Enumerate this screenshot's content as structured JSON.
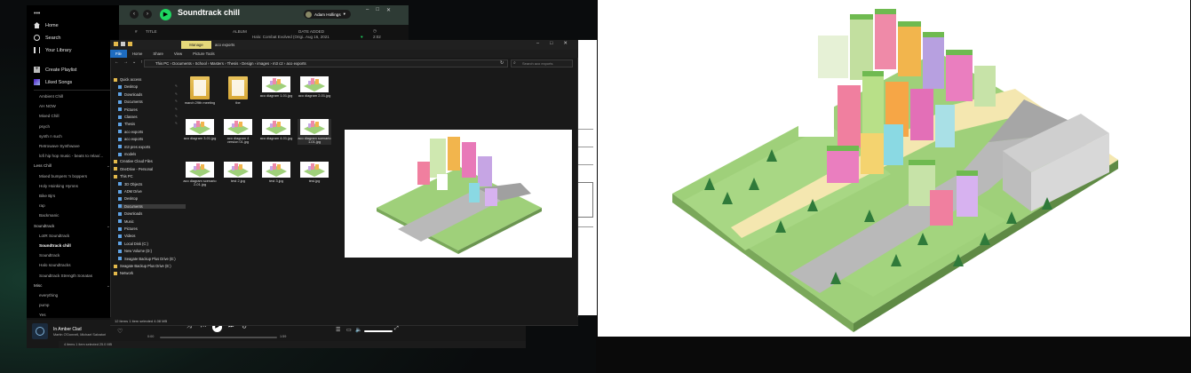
{
  "spotify": {
    "nav": {
      "home": "Home",
      "search": "Search",
      "library": "Your Library",
      "create": "Create Playlist",
      "liked": "Liked Songs"
    },
    "playlists": [
      {
        "label": "Ambient Chill",
        "type": "pl"
      },
      {
        "label": "AH NOW",
        "type": "pl"
      },
      {
        "label": "Mixed Chill",
        "type": "pl"
      },
      {
        "label": "psych",
        "type": "pl"
      },
      {
        "label": "synth n such",
        "type": "pl"
      },
      {
        "label": "Retrowave Synthwave",
        "type": "pl"
      },
      {
        "label": "lofi hip hop music - beats to relax/...",
        "type": "pl"
      },
      {
        "label": "Less Chill",
        "type": "folder"
      },
      {
        "label": "Mixed bumpers 'n boppers",
        "type": "pl"
      },
      {
        "label": "Holy Hoinking Hymns",
        "type": "pl"
      },
      {
        "label": "Bike Bjrs",
        "type": "pl"
      },
      {
        "label": "rap",
        "type": "pl"
      },
      {
        "label": "Backmanic",
        "type": "pl"
      },
      {
        "label": "Soundtrack",
        "type": "folder"
      },
      {
        "label": "LotR Soundtrack",
        "type": "pl"
      },
      {
        "label": "Soundtrack chill",
        "type": "active"
      },
      {
        "label": "Soundtrack",
        "type": "pl"
      },
      {
        "label": "Halo soundtracks",
        "type": "pl"
      },
      {
        "label": "Soundtrack Strength Sonatas",
        "type": "pl"
      },
      {
        "label": "Misc",
        "type": "folder"
      },
      {
        "label": "everything",
        "type": "pl"
      },
      {
        "label": "pump",
        "type": "pl"
      },
      {
        "label": "Yes",
        "type": "pl"
      }
    ],
    "header": {
      "title": "Soundtrack chill",
      "user": "Adam Hollings"
    },
    "columns": {
      "num": "#",
      "title": "TITLE",
      "album": "ALBUM",
      "date": "DATE ADDED"
    },
    "row": {
      "album": "Halo: Combat Evolved (Origi...",
      "date": "Aug 16, 2021",
      "time": "2:02"
    },
    "now_playing": {
      "track": "In Amber Clad",
      "artist": "Martin O'Donnell, Michael Salvatori",
      "elapsed": "0:00",
      "duration": "1:59",
      "progress": 0.0
    }
  },
  "explorer": {
    "manage": "Manage",
    "title": "aco exports",
    "ribbon": [
      "File",
      "Home",
      "Share",
      "View",
      "Picture Tools"
    ],
    "address": "This PC  ›  Documents  ›  School  ›  Masters  ›  Thesis  ›  Design  ›  images  ›  m3 c2  ›  aco exports",
    "search": "Search aco exports",
    "nav": [
      {
        "label": "Quick access",
        "indent": 0,
        "pin": false
      },
      {
        "label": "Desktop",
        "indent": 1,
        "pin": true
      },
      {
        "label": "Downloads",
        "indent": 1,
        "pin": true
      },
      {
        "label": "Documents",
        "indent": 1,
        "pin": true
      },
      {
        "label": "Pictures",
        "indent": 1,
        "pin": true
      },
      {
        "label": "Classes",
        "indent": 1,
        "pin": true
      },
      {
        "label": "Thesis",
        "indent": 1,
        "pin": true
      },
      {
        "label": "aco exports",
        "indent": 1,
        "pin": false
      },
      {
        "label": "aco exports",
        "indent": 1,
        "pin": false
      },
      {
        "label": "m3 pres exports",
        "indent": 1,
        "pin": false
      },
      {
        "label": "models",
        "indent": 1,
        "pin": false
      },
      {
        "label": "Creative Cloud Files",
        "indent": 0,
        "pin": false
      },
      {
        "label": "OneDrive - Personal",
        "indent": 0,
        "pin": false
      },
      {
        "label": "This PC",
        "indent": 0,
        "pin": false
      },
      {
        "label": "3D Objects",
        "indent": 1,
        "pin": false
      },
      {
        "label": "ADM Drive",
        "indent": 1,
        "pin": false
      },
      {
        "label": "Desktop",
        "indent": 1,
        "pin": false
      },
      {
        "label": "Documents",
        "indent": 1,
        "pin": false,
        "selected": true
      },
      {
        "label": "Downloads",
        "indent": 1,
        "pin": false
      },
      {
        "label": "Music",
        "indent": 1,
        "pin": false
      },
      {
        "label": "Pictures",
        "indent": 1,
        "pin": false
      },
      {
        "label": "Videos",
        "indent": 1,
        "pin": false
      },
      {
        "label": "Local Disk (C:)",
        "indent": 1,
        "pin": false
      },
      {
        "label": "New Volume (D:)",
        "indent": 1,
        "pin": false
      },
      {
        "label": "Seagate Backup Plus Drive (E:)",
        "indent": 1,
        "pin": false
      },
      {
        "label": "Seagate Backup Plus Drive (E:)",
        "indent": 0,
        "pin": false
      },
      {
        "label": "Network",
        "indent": 0,
        "pin": false
      }
    ],
    "files": [
      {
        "label": "march 29th meeting",
        "kind": "folder"
      },
      {
        "label": "tbe",
        "kind": "folder"
      },
      {
        "label": "aco diagram 1-01.jpg",
        "kind": "image"
      },
      {
        "label": "aco diagram 2-01.jpg",
        "kind": "image"
      },
      {
        "label": "aco diagram 3-01.jpg",
        "kind": "image"
      },
      {
        "label": "aco diagram 4 version 01.jpg",
        "kind": "image"
      },
      {
        "label": "aco diagram 4-01.jpg",
        "kind": "image"
      },
      {
        "label": "aco diagram scenario 1-01.jpg",
        "kind": "image",
        "selected": true
      },
      {
        "label": "aco diagram scenario 2-01.jpg",
        "kind": "image"
      },
      {
        "label": "test 2.jpg",
        "kind": "image"
      },
      {
        "label": "test 3.jpg",
        "kind": "image"
      },
      {
        "label": "test.jpg",
        "kind": "image"
      }
    ],
    "status": "12 items    1 item selected  4.08 MB",
    "bg_status": "4 items    1 item selected  25.0 MB"
  },
  "colors": {
    "spotify_green": "#1ed760",
    "manage_tab": "#e6d97a",
    "file_tab": "#1e6cc0",
    "grass": "#9fd07a",
    "road": "#b9b9b9",
    "path": "#f4e7b0"
  }
}
